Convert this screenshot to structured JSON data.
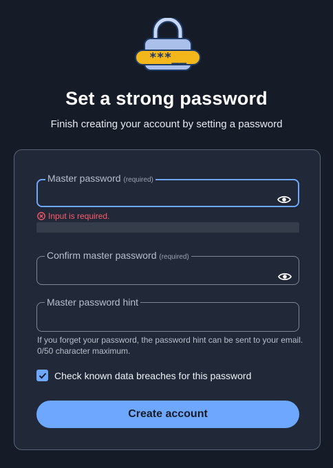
{
  "header": {
    "logo_icon": "padlock-password-icon",
    "logo_text": "***__",
    "title": "Set a strong password",
    "subtitle": "Finish creating your account by setting a password"
  },
  "form": {
    "master_password": {
      "label": "Master password",
      "required_tag": "(required)",
      "value": "",
      "error": "Input is required.",
      "strength": 0
    },
    "confirm_password": {
      "label": "Confirm master password",
      "required_tag": "(required)",
      "value": ""
    },
    "hint": {
      "label": "Master password hint",
      "value": "",
      "help": "If you forget your password, the password hint can be sent to your email. 0/50 character maximum."
    },
    "breach_check": {
      "label": "Check known data breaches for this password",
      "checked": true
    },
    "submit_label": "Create account"
  },
  "colors": {
    "background": "#151c28",
    "card": "#212938",
    "accent": "#6ea8fe",
    "error": "#ff5a6a"
  }
}
